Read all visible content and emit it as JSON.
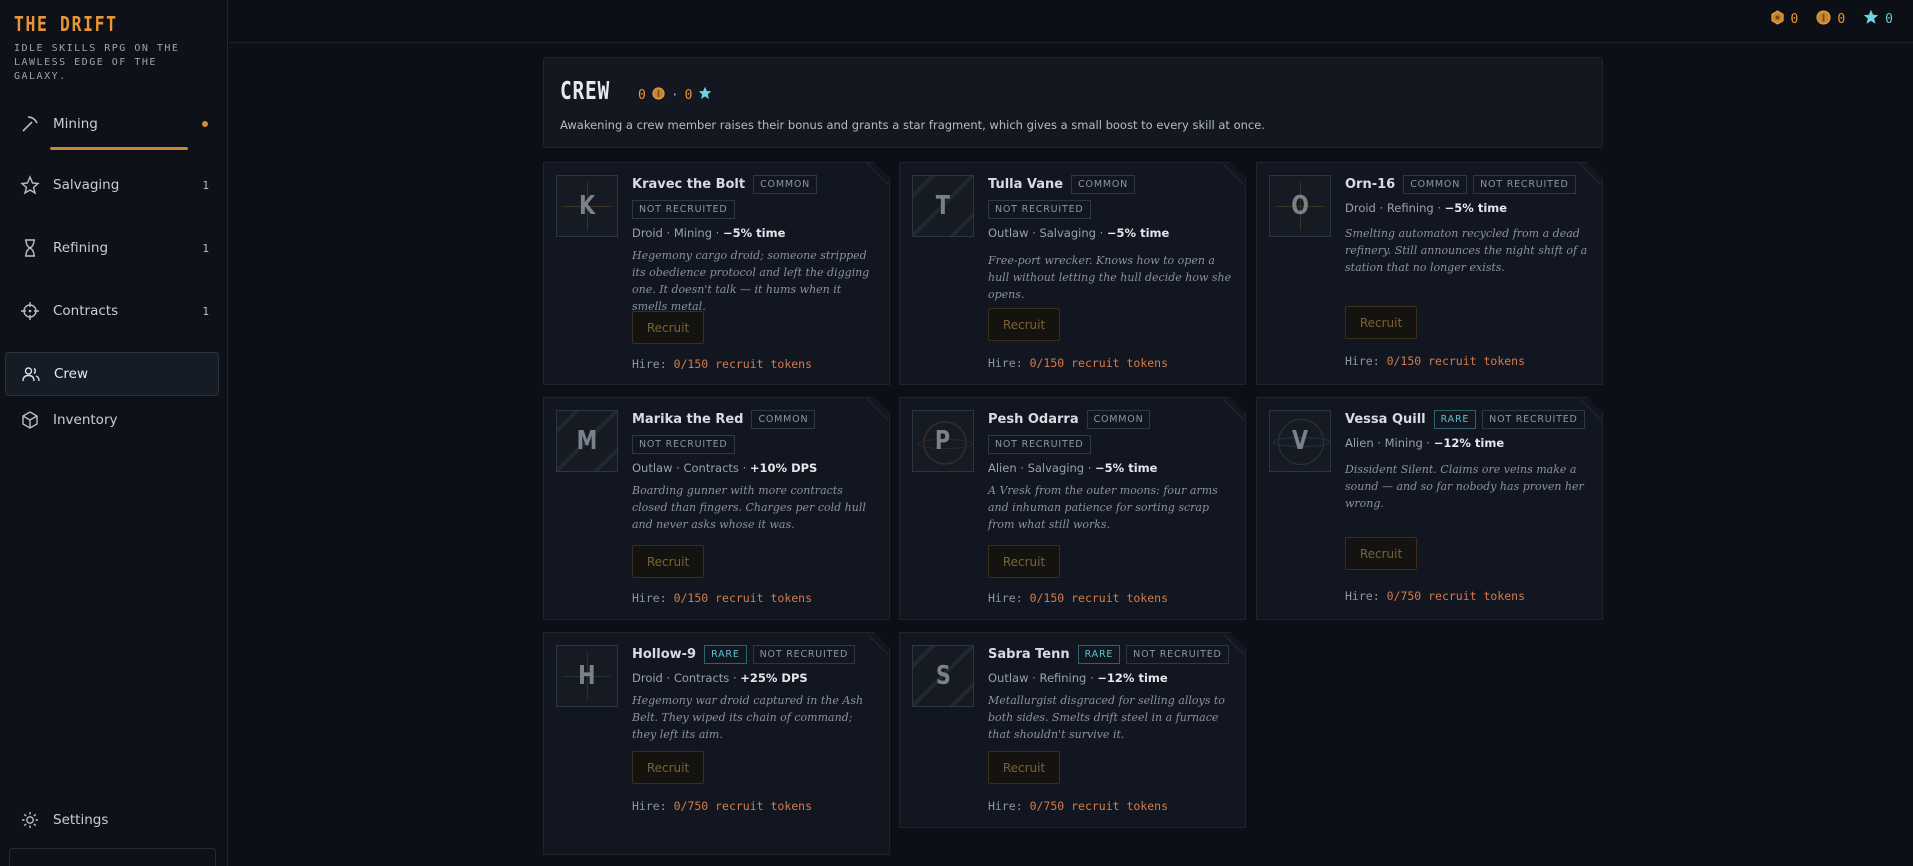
{
  "brand": {
    "title": "THE DRIFT",
    "subtitle": "IDLE SKILLS RPG ON THE LAWLESS EDGE OF THE GALAXY."
  },
  "nav": {
    "items": [
      {
        "label": "Mining",
        "icon": "pickaxe-icon",
        "count": ""
      },
      {
        "label": "Salvaging",
        "icon": "salvage-icon",
        "count": "1"
      },
      {
        "label": "Refining",
        "icon": "hourglass-icon",
        "count": "1"
      },
      {
        "label": "Contracts",
        "icon": "crosshair-icon",
        "count": "1"
      },
      {
        "label": "Crew",
        "icon": "users-icon",
        "count": ""
      },
      {
        "label": "Inventory",
        "icon": "box-icon",
        "count": ""
      }
    ],
    "settings": "Settings",
    "active": "Crew"
  },
  "currencies": [
    {
      "icon": "hex-token-icon",
      "value": "0"
    },
    {
      "icon": "coin-icon",
      "value": "0"
    },
    {
      "icon": "star-icon",
      "value": "0"
    }
  ],
  "crew_header": {
    "title": "CREW",
    "stat_a": "0",
    "stat_b": "0",
    "separator": "·",
    "description": "Awakening a crew member raises their bonus and grants a star fragment, which gives a small boost to every skill at once."
  },
  "labels": {
    "recruit": "Recruit",
    "hire_prefix": "Hire:",
    "not_recruited": "NOT RECRUITED"
  },
  "crew": [
    {
      "initial": "K",
      "name": "Kravec the Bolt",
      "rarity": "COMMON",
      "status": "NOT RECRUITED",
      "meta": "Droid · Mining · ",
      "bonus": "−5% time",
      "desc": "Hegemony cargo droid; someone stripped its obedience protocol and left the digging one. It doesn't talk — it hums when it smells metal.",
      "hire": "0/150 recruit tokens"
    },
    {
      "initial": "T",
      "name": "Tulla Vane",
      "rarity": "COMMON",
      "status": "NOT RECRUITED",
      "meta": "Outlaw · Salvaging · ",
      "bonus": "−5% time",
      "desc": "Free-port wrecker. Knows how to open a hull without letting the hull decide how she opens.",
      "hire": "0/150 recruit tokens"
    },
    {
      "initial": "O",
      "name": "Orn-16",
      "rarity": "COMMON",
      "status": "NOT RECRUITED",
      "meta": "Droid · Refining · ",
      "bonus": "−5% time",
      "desc": "Smelting automaton recycled from a dead refinery. Still announces the night shift of a station that no longer exists.",
      "hire": "0/150 recruit tokens"
    },
    {
      "initial": "M",
      "name": "Marika the Red",
      "rarity": "COMMON",
      "status": "NOT RECRUITED",
      "meta": "Outlaw · Contracts · ",
      "bonus": "+10% DPS",
      "desc": "Boarding gunner with more contracts closed than fingers. Charges per cold hull and never asks whose it was.",
      "hire": "0/150 recruit tokens"
    },
    {
      "initial": "P",
      "name": "Pesh Odarra",
      "rarity": "COMMON",
      "status": "NOT RECRUITED",
      "meta": "Alien · Salvaging · ",
      "bonus": "−5% time",
      "desc": "A Vresk from the outer moons: four arms and inhuman patience for sorting scrap from what still works.",
      "hire": "0/150 recruit tokens"
    },
    {
      "initial": "V",
      "name": "Vessa Quill",
      "rarity": "RARE",
      "status": "NOT RECRUITED",
      "meta": "Alien · Mining · ",
      "bonus": "−12% time",
      "desc": "Dissident Silent. Claims ore veins make a sound — and so far nobody has proven her wrong.",
      "hire": "0/750 recruit tokens"
    },
    {
      "initial": "H",
      "name": "Hollow-9",
      "rarity": "RARE",
      "status": "NOT RECRUITED",
      "meta": "Droid · Contracts · ",
      "bonus": "+25% DPS",
      "desc": "Hegemony war droid captured in the Ash Belt. They wiped its chain of command; they left its aim.",
      "hire": "0/750 recruit tokens"
    },
    {
      "initial": "S",
      "name": "Sabra Tenn",
      "rarity": "RARE",
      "status": "NOT RECRUITED",
      "meta": "Outlaw · Refining · ",
      "bonus": "−12% time",
      "desc": "Metallurgist disgraced for selling alloys to both sides. Smelts drift steel in a furnace that shouldn't survive it.",
      "hire": "0/750 recruit tokens"
    }
  ]
}
